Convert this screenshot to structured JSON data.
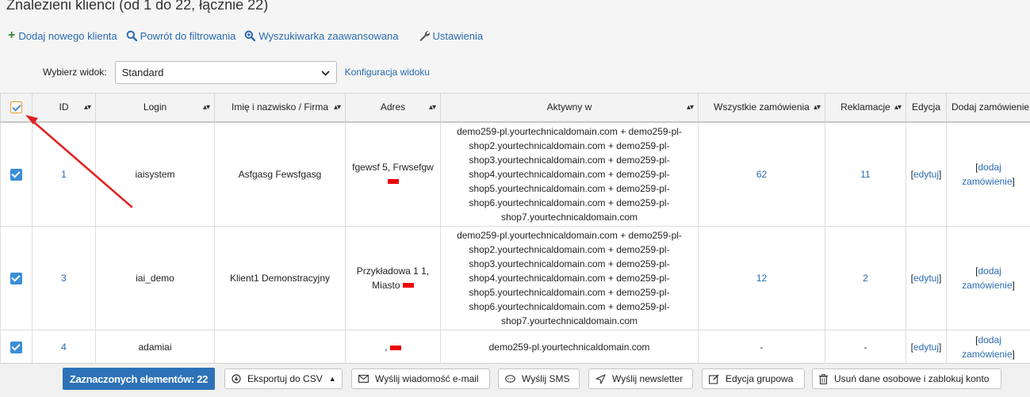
{
  "page": {
    "title": "Znalezieni klienci (od 1 do 22, łącznie 22)"
  },
  "actions": {
    "add_client": "Dodaj nowego klienta",
    "back_to_filter": "Powrót do filtrowania",
    "advanced_search": "Wyszukiwarka zaawansowana",
    "settings": "Ustawienia"
  },
  "view": {
    "label": "Wybierz widok:",
    "selected": "Standard",
    "config_link": "Konfiguracja widoku"
  },
  "table": {
    "columns": {
      "id": "ID",
      "login": "Login",
      "name": "Imię i nazwisko / Firma",
      "address": "Adres",
      "active_in": "Aktywny w",
      "all_orders": "Wszystkie zamówienia",
      "complaints": "Reklamacje",
      "edit": "Edycja",
      "add_order": "Dodaj zamówienie"
    },
    "rows": [
      {
        "id": "1",
        "login": "iaisystem",
        "name": "Asfgasg Fewsfgasg",
        "address": "fgewsf 5, Frwsefgw",
        "active_lines": [
          "demo259-pl.yourtechnicaldomain.com + demo259-pl-",
          "shop2.yourtechnicaldomain.com + demo259-pl-",
          "shop3.yourtechnicaldomain.com + demo259-pl-",
          "shop4.yourtechnicaldomain.com + demo259-pl-",
          "shop5.yourtechnicaldomain.com + demo259-pl-",
          "shop6.yourtechnicaldomain.com + demo259-pl-",
          "shop7.yourtechnicaldomain.com"
        ],
        "orders": "62",
        "complaints": "11",
        "edit_open": "[",
        "edit_link": "edytuj",
        "edit_close": "]",
        "add_open": "[",
        "add_link_1": "dodaj",
        "add_link_2": "zamówienie",
        "add_close": "]"
      },
      {
        "id": "3",
        "login": "iai_demo",
        "name": "Klient1 Demonstracyjny",
        "address_line1": "Przykładowa 1 1,",
        "address_line2": "Miasto",
        "active_lines": [
          "demo259-pl.yourtechnicaldomain.com + demo259-pl-",
          "shop2.yourtechnicaldomain.com + demo259-pl-",
          "shop3.yourtechnicaldomain.com + demo259-pl-",
          "shop4.yourtechnicaldomain.com + demo259-pl-",
          "shop5.yourtechnicaldomain.com + demo259-pl-",
          "shop6.yourtechnicaldomain.com + demo259-pl-",
          "shop7.yourtechnicaldomain.com"
        ],
        "orders": "12",
        "complaints": "2",
        "edit_open": "[",
        "edit_link": "edytuj",
        "edit_close": "]",
        "add_open": "[",
        "add_link_1": "dodaj",
        "add_link_2": "zamówienie",
        "add_close": "]"
      },
      {
        "id": "4",
        "login": "adamiai",
        "name": "",
        "address": ",",
        "active_lines": [
          "demo259-pl.yourtechnicaldomain.com"
        ],
        "orders": "-",
        "complaints": "-",
        "edit_open": "[",
        "edit_link": "edytuj",
        "edit_close": "]",
        "add_open": "[",
        "add_link_1": "dodaj",
        "add_link_2": "zamówienie",
        "add_close": "]"
      }
    ]
  },
  "bottom_bar": {
    "selected_count": "Zaznaczonych elementów: 22",
    "export_csv": "Eksportuj do CSV",
    "send_email": "Wyślij wiadomość e-mail",
    "send_sms": "Wyślij SMS",
    "send_newsletter": "Wyślij newsletter",
    "group_edit": "Edycja grupowa",
    "delete_data": "Usuń dane osobowe i zablokuj konto"
  },
  "colors": {
    "link": "#2a6bb0",
    "badge": "#2d72b8",
    "checkbox": "#3b8ed9",
    "annotation_arrow": "#e02020",
    "redaction": "#e00000"
  }
}
